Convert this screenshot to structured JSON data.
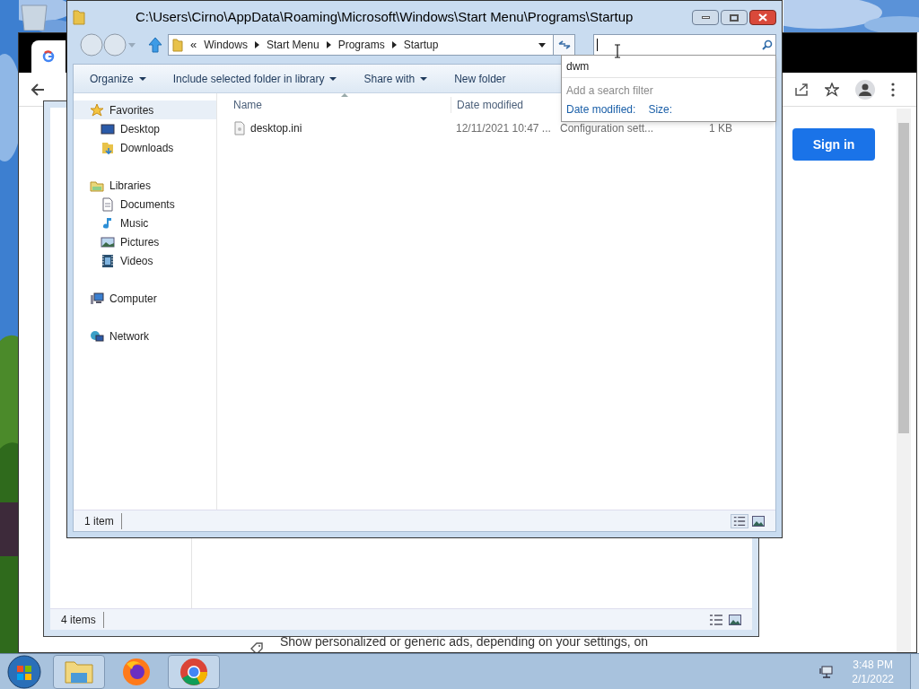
{
  "browser": {
    "sign_in": "Sign in",
    "ad_text": "Show personalized or generic ads, depending on your settings, on"
  },
  "back_explorer": {
    "status": "4 items"
  },
  "explorer": {
    "title": "C:\\Users\\Cirno\\AppData\\Roaming\\Microsoft\\Windows\\Start Menu\\Programs\\Startup",
    "crumb_prefix": "«",
    "breadcrumb": [
      "Windows",
      "Start Menu",
      "Programs",
      "Startup"
    ],
    "toolbar": [
      {
        "label": "Organize",
        "dropdown": true
      },
      {
        "label": "Include selected folder in library",
        "dropdown": true
      },
      {
        "label": "Share with",
        "dropdown": true
      },
      {
        "label": "New folder",
        "dropdown": false
      }
    ],
    "nav": [
      {
        "label": "Favorites",
        "kind": "star",
        "selected": true,
        "children": [
          {
            "label": "Desktop",
            "kind": "desktop",
            "selected": false
          },
          {
            "label": "Downloads",
            "kind": "download",
            "selected": false
          }
        ]
      },
      {
        "label": "Libraries",
        "kind": "library",
        "selected": false,
        "children": [
          {
            "label": "Documents",
            "kind": "document",
            "selected": false
          },
          {
            "label": "Music",
            "kind": "music",
            "selected": false
          },
          {
            "label": "Pictures",
            "kind": "pictures",
            "selected": false
          },
          {
            "label": "Videos",
            "kind": "videos",
            "selected": false
          }
        ]
      },
      {
        "label": "Computer",
        "kind": "computer",
        "selected": false
      },
      {
        "label": "Network",
        "kind": "network",
        "selected": false
      }
    ],
    "columns": [
      "Name",
      "Date modified"
    ],
    "files": [
      {
        "name": "desktop.ini",
        "date": "12/11/2021 10:47 ...",
        "type": "Configuration sett...",
        "size": "1 KB"
      }
    ],
    "status": "1 item",
    "search": {
      "suggestion": "dwm",
      "filter_hint": "Add a search filter",
      "filters": [
        "Date modified:",
        "Size:"
      ]
    }
  },
  "taskbar": {
    "items": [
      {
        "kind": "explorer",
        "open": true
      },
      {
        "kind": "firefox",
        "open": false
      },
      {
        "kind": "chrome",
        "open": true
      }
    ],
    "time": "3:48 PM",
    "date": "2/1/2022"
  }
}
